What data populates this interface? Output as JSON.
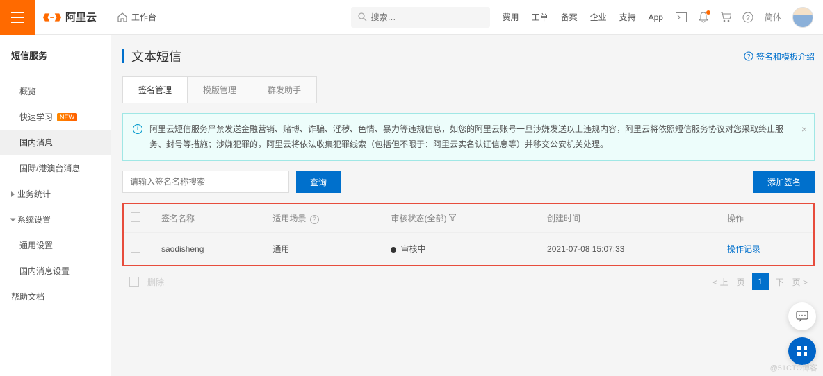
{
  "header": {
    "brand": "阿里云",
    "workbench": "工作台",
    "search_placeholder": "搜索…",
    "nav": [
      "费用",
      "工单",
      "备案",
      "企业",
      "支持",
      "App"
    ],
    "lang": "简体"
  },
  "sidebar": {
    "title": "短信服务",
    "items": [
      {
        "label": "概览"
      },
      {
        "label": "快速学习",
        "badge": "NEW"
      },
      {
        "label": "国内消息",
        "active": true
      },
      {
        "label": "国际/港澳台消息"
      }
    ],
    "groups": [
      {
        "label": "业务统计",
        "open": false
      },
      {
        "label": "系统设置",
        "open": true,
        "children": [
          "通用设置",
          "国内消息设置"
        ]
      }
    ],
    "help": "帮助文档"
  },
  "page": {
    "title": "文本短信",
    "help_link": "签名和模板介绍",
    "tabs": [
      "签名管理",
      "模版管理",
      "群发助手"
    ],
    "active_tab": 0,
    "alert": "阿里云短信服务严禁发送金融营销、赌博、诈骗、淫秽、色情、暴力等违规信息，如您的阿里云账号一旦涉嫌发送以上违规内容，阿里云将依照短信服务协议对您采取终止服务、封号等措施；涉嫌犯罪的，阿里云将依法收集犯罪线索（包括但不限于：阿里云实名认证信息等）并移交公安机关处理。",
    "search_placeholder": "请输入签名名称搜索",
    "btn_search": "查询",
    "btn_add": "添加签名",
    "columns": {
      "name": "签名名称",
      "scene": "适用场景",
      "status": "审核状态(全部)",
      "created": "创建时间",
      "action": "操作"
    },
    "rows": [
      {
        "name": "saodisheng",
        "scene": "通用",
        "status": "审核中",
        "created": "2021-07-08 15:07:33",
        "action": "操作记录"
      }
    ],
    "footer": {
      "delete": "删除",
      "prev": "上一页",
      "next": "下一页",
      "page": "1"
    }
  },
  "watermark": "@51CTO博客"
}
